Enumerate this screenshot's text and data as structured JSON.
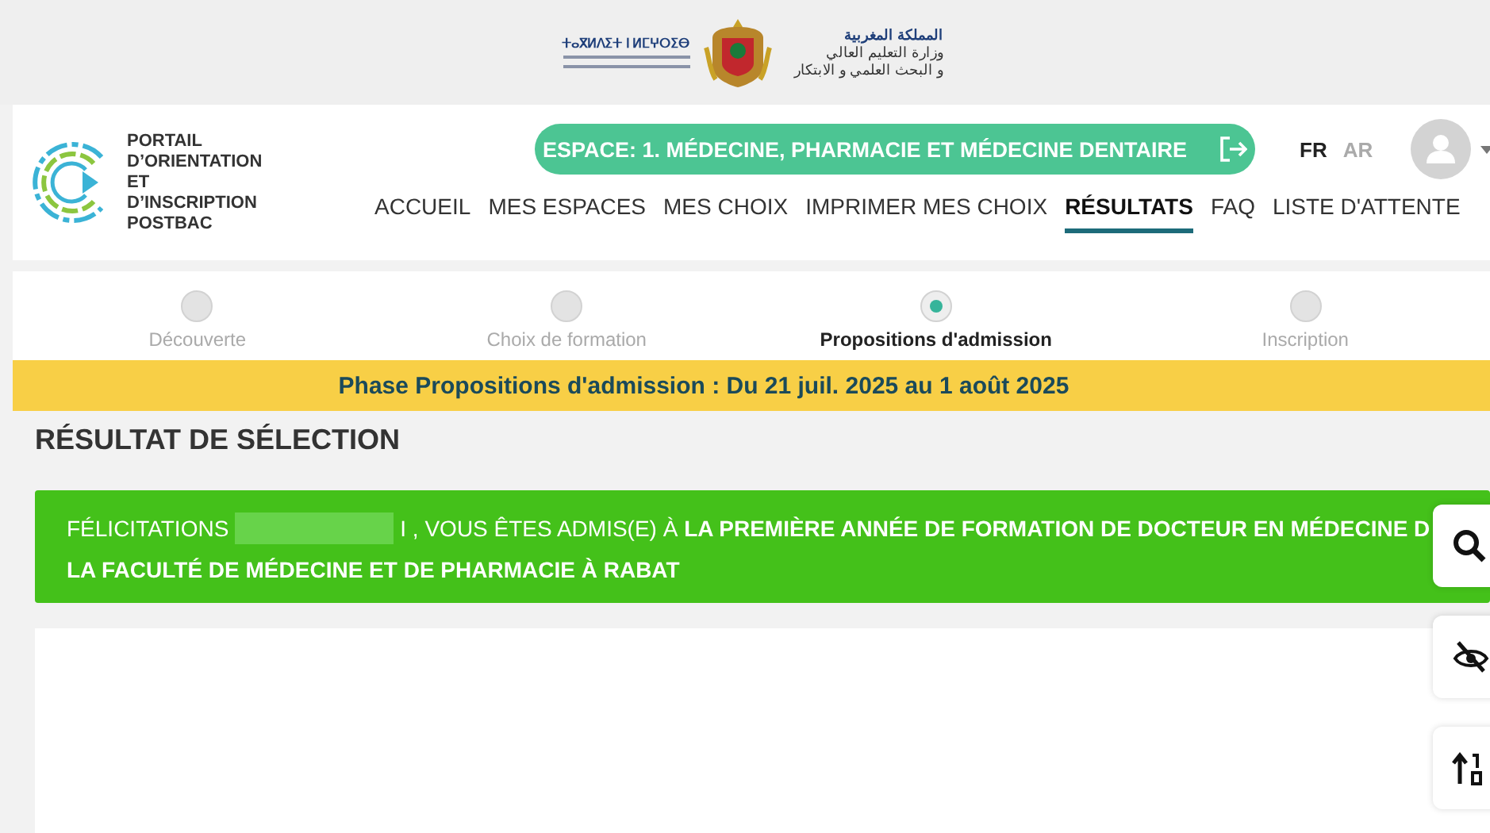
{
  "ministry": {
    "tifinagh": "ⵜⴰⴳⵍⴷⵉⵜ ⵏ ⵍⵎⵖⵔⵉⴱ",
    "arabic": [
      "المملكة المغربية",
      "وزارة التعليم العالي",
      "و البحث العلمي و الابتكار"
    ]
  },
  "portal": {
    "title": "PORTAIL D’ORIENTATION ET D’INSCRIPTION POSTBAC"
  },
  "space_button": {
    "label": "ESPACE: 1. MÉDECINE, PHARMACIE ET MÉDECINE DENTAIRE"
  },
  "languages": [
    {
      "label": "FR",
      "selected": true
    },
    {
      "label": "AR",
      "selected": false
    }
  ],
  "nav": [
    {
      "label": "ACCUEIL",
      "selected": false
    },
    {
      "label": "MES ESPACES",
      "selected": false
    },
    {
      "label": "MES CHOIX",
      "selected": false
    },
    {
      "label": "IMPRIMER MES CHOIX",
      "selected": false
    },
    {
      "label": "RÉSULTATS",
      "selected": true
    },
    {
      "label": "FAQ",
      "selected": false
    },
    {
      "label": "LISTE D'ATTENTE",
      "selected": false
    }
  ],
  "steps": [
    {
      "label": "Découverte",
      "selected": false
    },
    {
      "label": "Choix de formation",
      "selected": false
    },
    {
      "label": "Propositions d'admission",
      "selected": true
    },
    {
      "label": "Inscription",
      "selected": false
    }
  ],
  "phase_banner": "Phase Propositions d'admission : Du 21 juil. 2025 au 1 août 2025",
  "section_title": "RÉSULTAT DE SÉLECTION",
  "result": {
    "greeting": "FÉLICITATIONS",
    "name_redacted": true,
    "line_1": "I , VOUS ÊTES ADMIS(E) À **LA PREMIÈRE ANNÉE DE FORMATION DE DOCTEUR EN MÉDECINE D**",
    "line_2": "LA FACULTÉ DE MÉDECINE ET DE PHARMACIE À RABAT"
  },
  "side_tools": [
    {
      "kind": "search"
    },
    {
      "kind": "hide"
    },
    {
      "kind": "sort"
    }
  ]
}
